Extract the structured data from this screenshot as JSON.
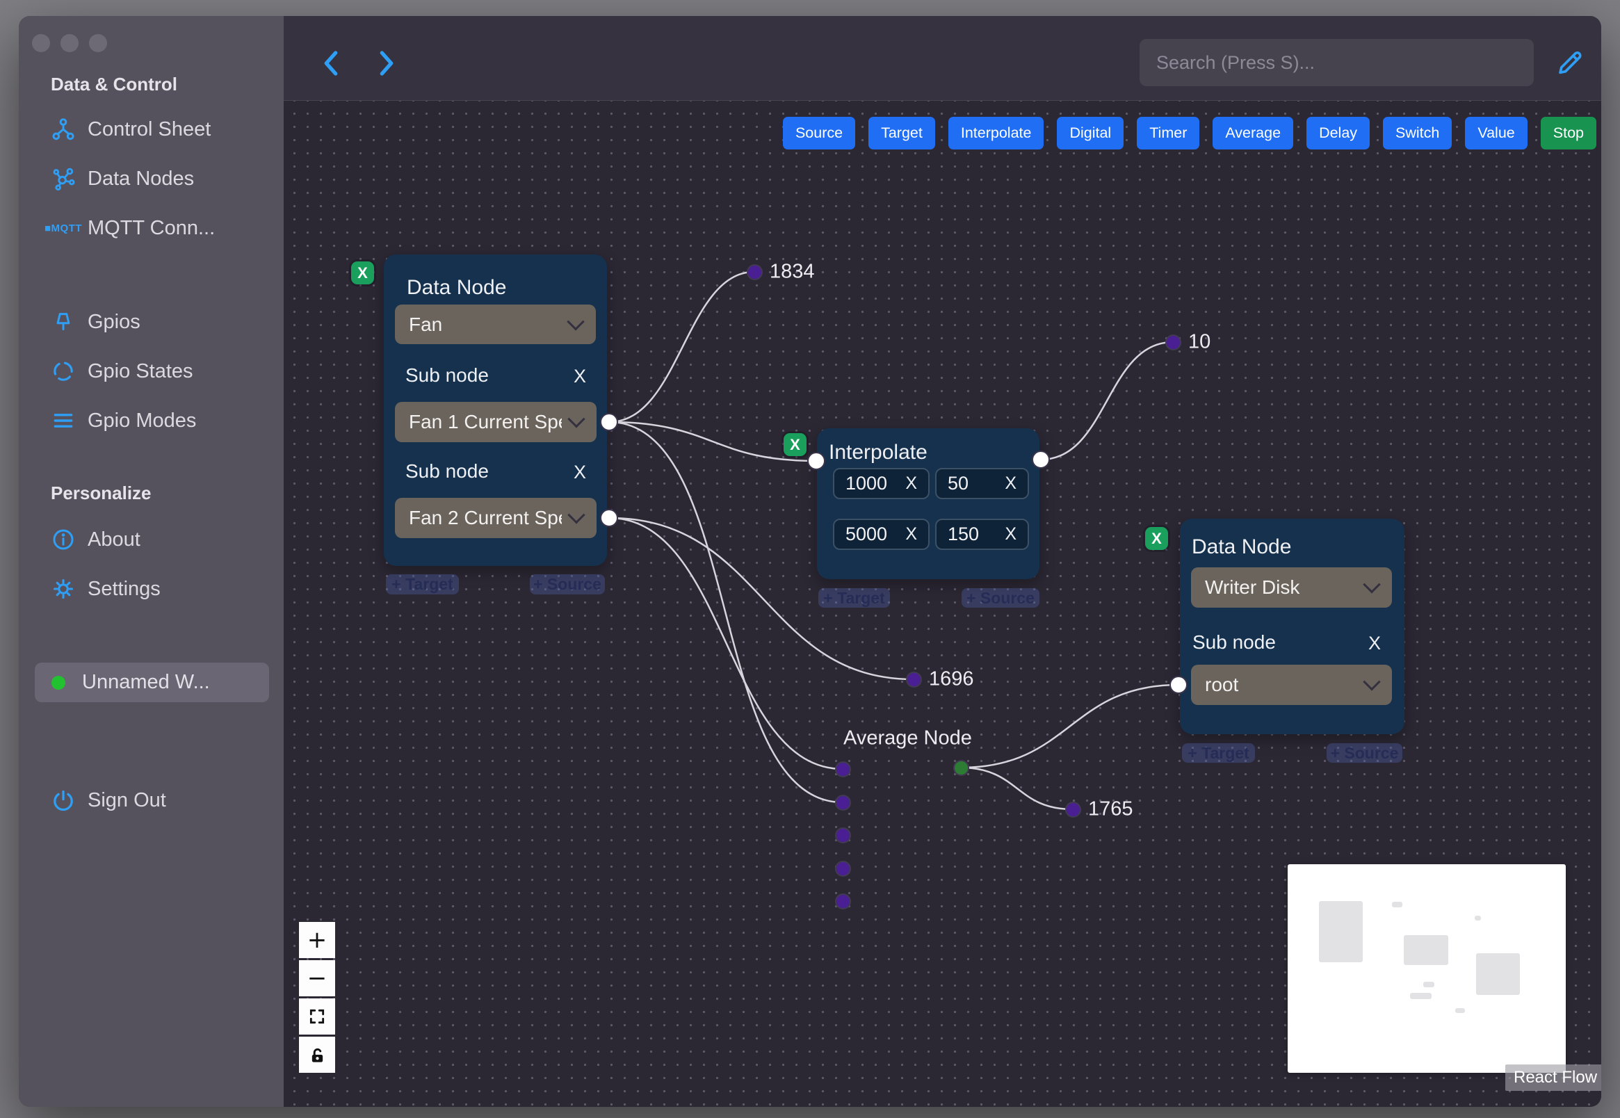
{
  "colors": {
    "accent_blue": "#1f6ef3",
    "icon_blue": "#2f9ff5",
    "stop_green": "#189450",
    "delete_green": "#1aa05c",
    "node_bg": "#15314d",
    "canvas_bg": "#2b2733",
    "sidebar_bg": "#56525d",
    "edge": "#d6d4dc",
    "purple_dot": "#4a1f93",
    "green_dot": "#2d7c34",
    "workflow_status_green": "#21c12f"
  },
  "sidebar": {
    "section_data_control": "Data & Control",
    "items": [
      {
        "label": "Control Sheet",
        "icon": "control-sheet-icon"
      },
      {
        "label": "Data Nodes",
        "icon": "data-nodes-icon"
      },
      {
        "label": "MQTT Conn...",
        "icon": "mqtt-icon",
        "badge": "■MQTT"
      },
      {
        "label": "Gpios",
        "icon": "pin-icon"
      },
      {
        "label": "Gpio States",
        "icon": "dashed-circle-icon"
      },
      {
        "label": "Gpio Modes",
        "icon": "lines-icon"
      }
    ],
    "section_personalize": "Personalize",
    "items2": [
      {
        "label": "About",
        "icon": "info-icon"
      },
      {
        "label": "Settings",
        "icon": "gear-icon"
      }
    ],
    "workflow": {
      "label": "Unnamed W...",
      "status": "online"
    },
    "sign_out": "Sign Out"
  },
  "topbar": {
    "search_placeholder": "Search (Press S)..."
  },
  "toolbar": {
    "buttons": [
      {
        "label": "Source"
      },
      {
        "label": "Target"
      },
      {
        "label": "Interpolate"
      },
      {
        "label": "Digital"
      },
      {
        "label": "Timer"
      },
      {
        "label": "Average"
      },
      {
        "label": "Delay"
      },
      {
        "label": "Switch"
      },
      {
        "label": "Value"
      },
      {
        "label": "Stop",
        "variant": "green"
      }
    ]
  },
  "labels": {
    "x": "X"
  },
  "pills": {
    "target": "+ Target",
    "source": "+ Source"
  },
  "nodes": {
    "fan": {
      "title": "Data Node",
      "type_value": "Fan",
      "sub_label": "Sub node",
      "sub1_value": "Fan 1 Current Spe",
      "sub2_value": "Fan 2 Current Spe"
    },
    "interpolate": {
      "title": "Interpolate",
      "values": [
        "1000",
        "50",
        "5000",
        "150"
      ]
    },
    "writer": {
      "title": "Data Node",
      "type_value": "Writer Disk",
      "sub_label": "Sub node",
      "sub_value": "root"
    },
    "average": {
      "title": "Average Node"
    }
  },
  "edge_labels": {
    "e1834": "1834",
    "e10": "10",
    "e1696": "1696",
    "e1765": "1765"
  },
  "controls": {
    "zoom_in": "+",
    "zoom_out": "−"
  },
  "attribution": "React Flow"
}
